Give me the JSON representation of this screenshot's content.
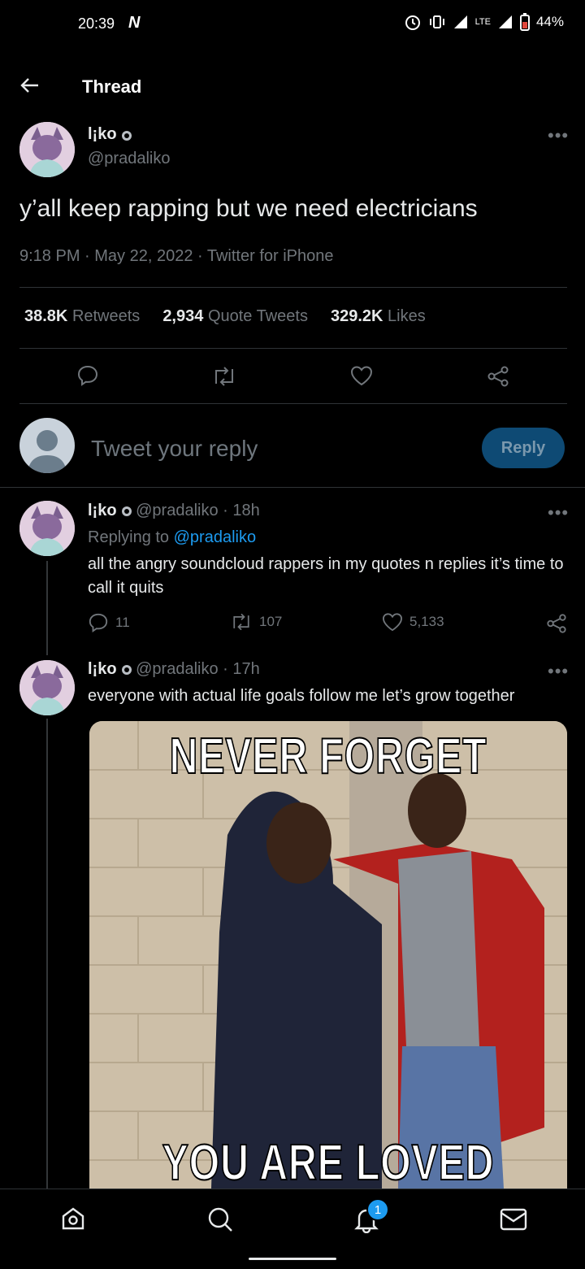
{
  "status_bar": {
    "time": "20:39",
    "carrier_icon": "N",
    "network": "LTE",
    "battery": "44%"
  },
  "header": {
    "title": "Thread"
  },
  "main_tweet": {
    "name": "l¡ko",
    "handle": "@pradaliko",
    "text": "y’all keep rapping but we need electricians",
    "meta": "9:18 PM · May 22, 2022 · Twitter for iPhone",
    "stats": {
      "retweets_count": "38.8K",
      "retweets_label": "Retweets",
      "quotes_count": "2,934",
      "quotes_label": "Quote Tweets",
      "likes_count": "329.2K",
      "likes_label": "Likes"
    }
  },
  "composer": {
    "placeholder": "Tweet your reply",
    "button": "Reply"
  },
  "replies": [
    {
      "name": "l¡ko",
      "handle": "@pradaliko",
      "time": "· 18h",
      "replying_prefix": "Replying to",
      "replying_handle": "@pradaliko",
      "text": "all the angry soundcloud rappers in my quotes n replies it’s time to call it quits",
      "replies_count": "11",
      "retweets_count": "107",
      "likes_count": "5,133"
    },
    {
      "name": "l¡ko",
      "handle": "@pradaliko",
      "time": "· 17h",
      "text": "everyone with actual life goals follow me let’s grow together",
      "image_top": "NEVER FORGET",
      "image_bottom": "YOU ARE LOVED"
    }
  ],
  "nav": {
    "notifications_badge": "1"
  }
}
